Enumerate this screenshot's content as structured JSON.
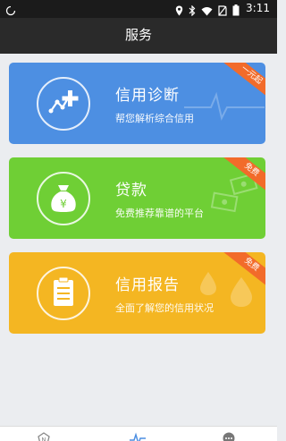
{
  "status_bar": {
    "time": "3:11",
    "icons": [
      "location-icon",
      "bluetooth-icon",
      "wifi-icon",
      "no-sim-icon",
      "battery-icon"
    ]
  },
  "header": {
    "title": "服务"
  },
  "cards": [
    {
      "title": "信用诊断",
      "subtitle": "帮您解析综合信用",
      "ribbon": "一元起",
      "color": "#4d8fe2",
      "icon": "credit-diagnosis-icon"
    },
    {
      "title": "贷款",
      "subtitle": "免费推荐靠谱的平台",
      "ribbon": "免费",
      "color": "#6fcf35",
      "icon": "money-bag-icon"
    },
    {
      "title": "信用报告",
      "subtitle": "全面了解您的信用状况",
      "ribbon": "免费",
      "color": "#f4b622",
      "icon": "report-clipboard-icon"
    }
  ],
  "bottom_nav": {
    "items": [
      {
        "icon": "news-icon",
        "active": false
      },
      {
        "icon": "pulse-icon",
        "active": true
      },
      {
        "icon": "more-icon",
        "active": false
      }
    ],
    "active_color": "#4d8fe2"
  }
}
